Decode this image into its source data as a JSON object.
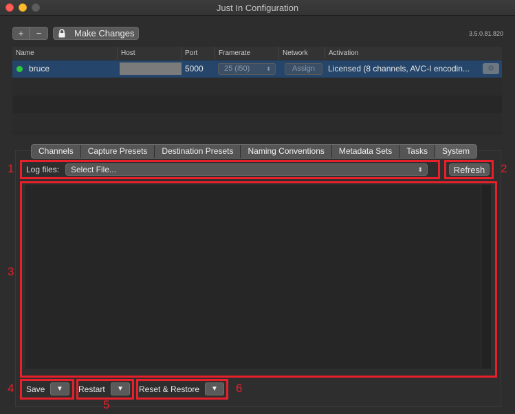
{
  "window": {
    "title": "Just In Configuration"
  },
  "toolbar": {
    "add_label": "+",
    "remove_label": "−",
    "make_changes_label": "Make Changes",
    "version": "3.5.0.81.820"
  },
  "table": {
    "columns": [
      "Name",
      "Host",
      "Port",
      "Framerate",
      "Network",
      "Activation"
    ],
    "row": {
      "name": "bruce",
      "port": "5000",
      "framerate": "25 (i50)",
      "network_button": "Assign",
      "activation": "Licensed (8 channels, AVC-I encodin..."
    }
  },
  "tabs": [
    "Channels",
    "Capture Presets",
    "Destination Presets",
    "Naming Conventions",
    "Metadata Sets",
    "Tasks",
    "System"
  ],
  "system": {
    "log_files_label": "Log files:",
    "log_select_value": "Select File...",
    "refresh_label": "Refresh",
    "save_label": "Save",
    "restart_label": "Restart",
    "reset_restore_label": "Reset & Restore"
  },
  "annotations": [
    "1",
    "2",
    "3",
    "4",
    "5",
    "6"
  ],
  "colors": {
    "annotation": "#e8202a",
    "selected_row": "#25466a",
    "status_online": "#2ccb3f"
  },
  "icons": {
    "lock": "lock-icon",
    "gear": "gear-icon",
    "dropdown": "triangle-down-icon"
  }
}
